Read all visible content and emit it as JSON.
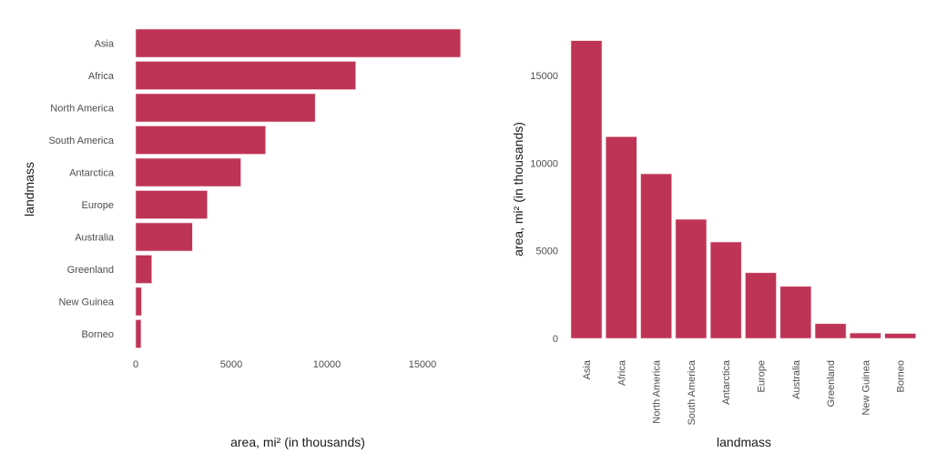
{
  "chart_data": [
    {
      "type": "bar",
      "orientation": "horizontal",
      "categories": [
        "Asia",
        "Africa",
        "North America",
        "South America",
        "Antarctica",
        "Europe",
        "Australia",
        "Greenland",
        "New Guinea",
        "Borneo"
      ],
      "values": [
        16988,
        11506,
        9390,
        6795,
        5500,
        3745,
        2968,
        840,
        306,
        280
      ],
      "xlabel": "area, mi² (in thousands)",
      "ylabel": "landmass",
      "xlim": [
        0,
        17000
      ],
      "xticks": [
        "0",
        "5000",
        "10000",
        "15000"
      ],
      "xtick_values": [
        0,
        5000,
        10000,
        15000
      ],
      "grid": false,
      "bar_color": "#be3455"
    },
    {
      "type": "bar",
      "orientation": "vertical",
      "categories": [
        "Asia",
        "Africa",
        "North America",
        "South America",
        "Antarctica",
        "Europe",
        "Australia",
        "Greenland",
        "New Guinea",
        "Borneo"
      ],
      "values": [
        16988,
        11506,
        9390,
        6795,
        5500,
        3745,
        2968,
        840,
        306,
        280
      ],
      "xlabel": "landmass",
      "ylabel": "area, mi² (in thousands)",
      "ylim": [
        0,
        17000
      ],
      "yticks": [
        "0",
        "5000",
        "10000",
        "15000"
      ],
      "ytick_values": [
        0,
        5000,
        10000,
        15000
      ],
      "grid": false,
      "bar_color": "#be3455"
    }
  ]
}
